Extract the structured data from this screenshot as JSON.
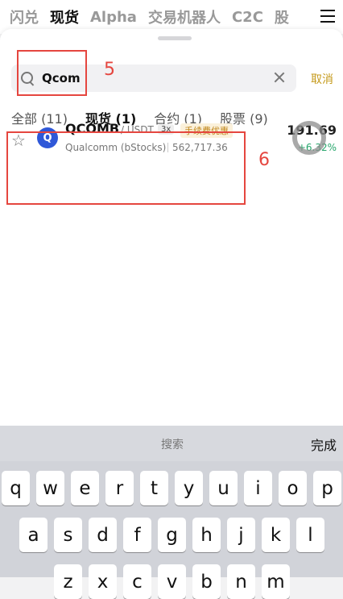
{
  "top_nav": {
    "items": [
      "闪兑",
      "现货",
      "Alpha",
      "交易机器人",
      "C2C",
      "股"
    ],
    "active_index": 1
  },
  "search": {
    "value": "Qcom",
    "cancel_label": "取消"
  },
  "tabs": [
    {
      "label": "全部 (11)",
      "active": false
    },
    {
      "label": "现货 (1)",
      "active": true
    },
    {
      "label": "合约 (1)",
      "active": false
    },
    {
      "label": "股票 (9)",
      "active": false
    }
  ],
  "result": {
    "symbol": "QCOMB",
    "quote": "/ USDT",
    "leverage": "3x",
    "promo": "手续费优惠",
    "name": "Qualcomm (bStocks)",
    "volume": "562,717.36",
    "price": "191.69",
    "change": "+6.32%",
    "logo_letter": "Q",
    "change_color": "#26a66b"
  },
  "annotations": {
    "search_marker": "5",
    "result_marker": "6",
    "color": "#e5463f"
  },
  "keyboard": {
    "bar_label": "搜索",
    "done_label": "完成",
    "row1": [
      "q",
      "w",
      "e",
      "r",
      "t",
      "y",
      "u",
      "i",
      "o",
      "p"
    ],
    "row2": [
      "a",
      "s",
      "d",
      "f",
      "g",
      "h",
      "j",
      "k",
      "l"
    ],
    "row3": [
      "z",
      "x",
      "c",
      "v",
      "b",
      "n",
      "m"
    ]
  },
  "colors": {
    "accent": "#c59a1b",
    "brand_logo": "#2f58d8"
  }
}
